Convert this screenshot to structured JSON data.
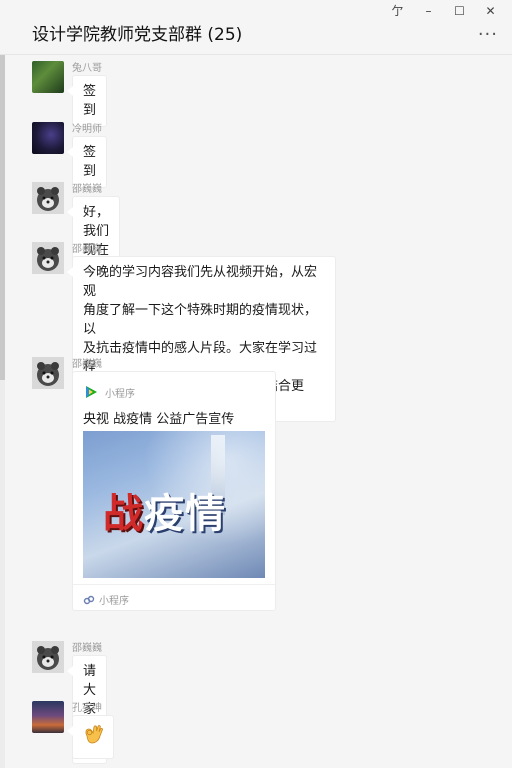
{
  "window": {
    "title": "设计学院教师党支部群 (25)",
    "buttons": {
      "pin": "亇",
      "minimize": "–",
      "maximize": "☐",
      "close": "✕"
    },
    "more": "···"
  },
  "messages": [
    {
      "sender": "兔八哥",
      "text": "签到",
      "avatar": "nature-photo"
    },
    {
      "sender": "冷明师",
      "text": "签到",
      "avatar": "starry-night"
    },
    {
      "sender": "邵巍巍",
      "text": "好，我们现在开始学习。",
      "avatar": "bear"
    },
    {
      "sender": "邵巍巍",
      "text_lines": [
        "今晚的学习内容我们先从视频开始，从宏观",
        "角度了解一下这个特殊时期的疫情现状，以",
        "及抗击疫情中的感人片段。大家在学习过程",
        "中，可自行发表学习感想，图文结合更好。"
      ],
      "avatar": "bear"
    },
    {
      "sender": "邵巍巍",
      "avatar": "bear",
      "mini_program": {
        "label_top": "小程序",
        "title": "央视 战疫情 公益广告宣传",
        "image_text_red": "战",
        "image_text_white": "疫情",
        "label_bottom": "小程序"
      }
    },
    {
      "sender": "邵巍巍",
      "text": "请大家收看",
      "avatar": "bear"
    },
    {
      "sender": "孔宪坤",
      "emoji": "ok-hand",
      "avatar": "sunset"
    }
  ],
  "colors": {
    "background": "#f5f5f5",
    "bubble": "#ffffff",
    "nickname": "#9c9c9c",
    "mini_program_icon": "#1aad19"
  }
}
